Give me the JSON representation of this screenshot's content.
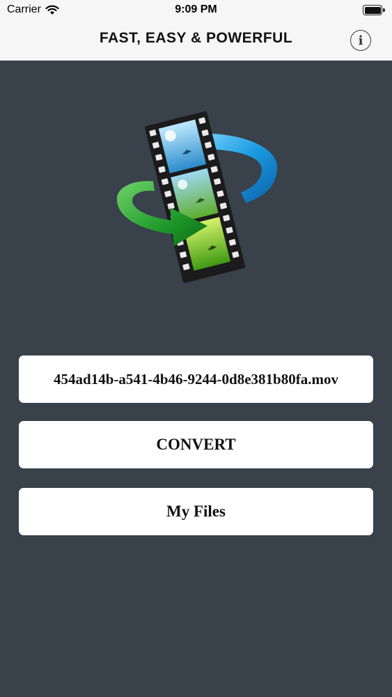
{
  "status_bar": {
    "carrier": "Carrier",
    "time": "9:09 PM",
    "icons": [
      "wifi-icon",
      "battery-icon"
    ]
  },
  "nav": {
    "title": "FAST, EASY & POWERFUL",
    "info_icon": "info-icon",
    "info_glyph": "i"
  },
  "main": {
    "logo_icon": "video-convert-icon",
    "file_button_label": "454ad14b-a541-4b46-9244-0d8e381b80fa.mov",
    "convert_button_label": "CONVERT",
    "my_files_button_label": "My Files"
  },
  "colors": {
    "background": "#39414b",
    "nav_background": "#f6f6f6",
    "button_background": "#ffffff"
  }
}
